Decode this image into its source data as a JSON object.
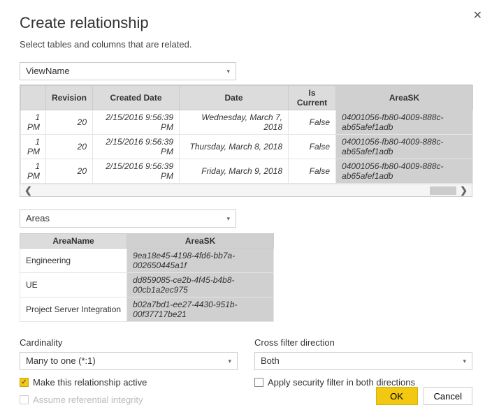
{
  "title": "Create relationship",
  "subtitle": "Select tables and columns that are related.",
  "close": "✕",
  "table1": {
    "dropdown": "ViewName",
    "headers": {
      "c0": "",
      "c1": "Revision",
      "c2": "Created Date",
      "c3": "Date",
      "c4": "Is Current",
      "c5": "AreaSK"
    },
    "rows": [
      {
        "c0": "1 PM",
        "c1": "20",
        "c2": "2/15/2016 9:56:39 PM",
        "c3": "Wednesday, March 7, 2018",
        "c4": "False",
        "c5": "04001056-fb80-4009-888c-ab65afef1adb"
      },
      {
        "c0": "1 PM",
        "c1": "20",
        "c2": "2/15/2016 9:56:39 PM",
        "c3": "Thursday, March 8, 2018",
        "c4": "False",
        "c5": "04001056-fb80-4009-888c-ab65afef1adb"
      },
      {
        "c0": "1 PM",
        "c1": "20",
        "c2": "2/15/2016 9:56:39 PM",
        "c3": "Friday, March 9, 2018",
        "c4": "False",
        "c5": "04001056-fb80-4009-888c-ab65afef1adb"
      }
    ]
  },
  "table2": {
    "dropdown": "Areas",
    "headers": {
      "c0": "AreaName",
      "c1": "AreaSK"
    },
    "rows": [
      {
        "c0": "Engineering",
        "c1": "9ea18e45-4198-4fd6-bb7a-002650445a1f"
      },
      {
        "c0": "UE",
        "c1": "dd859085-ce2b-4f45-b4b8-00cb1a2ec975"
      },
      {
        "c0": "Project Server Integration",
        "c1": "b02a7bd1-ee27-4430-951b-00f37717be21"
      }
    ]
  },
  "cardinality": {
    "label": "Cardinality",
    "value": "Many to one (*:1)"
  },
  "crossfilter": {
    "label": "Cross filter direction",
    "value": "Both"
  },
  "cb_active": "Make this relationship active",
  "cb_security": "Apply security filter in both directions",
  "cb_integrity": "Assume referential integrity",
  "check": "✓",
  "buttons": {
    "ok": "OK",
    "cancel": "Cancel"
  },
  "chev": "▾",
  "arrL": "❮",
  "arrR": "❯"
}
